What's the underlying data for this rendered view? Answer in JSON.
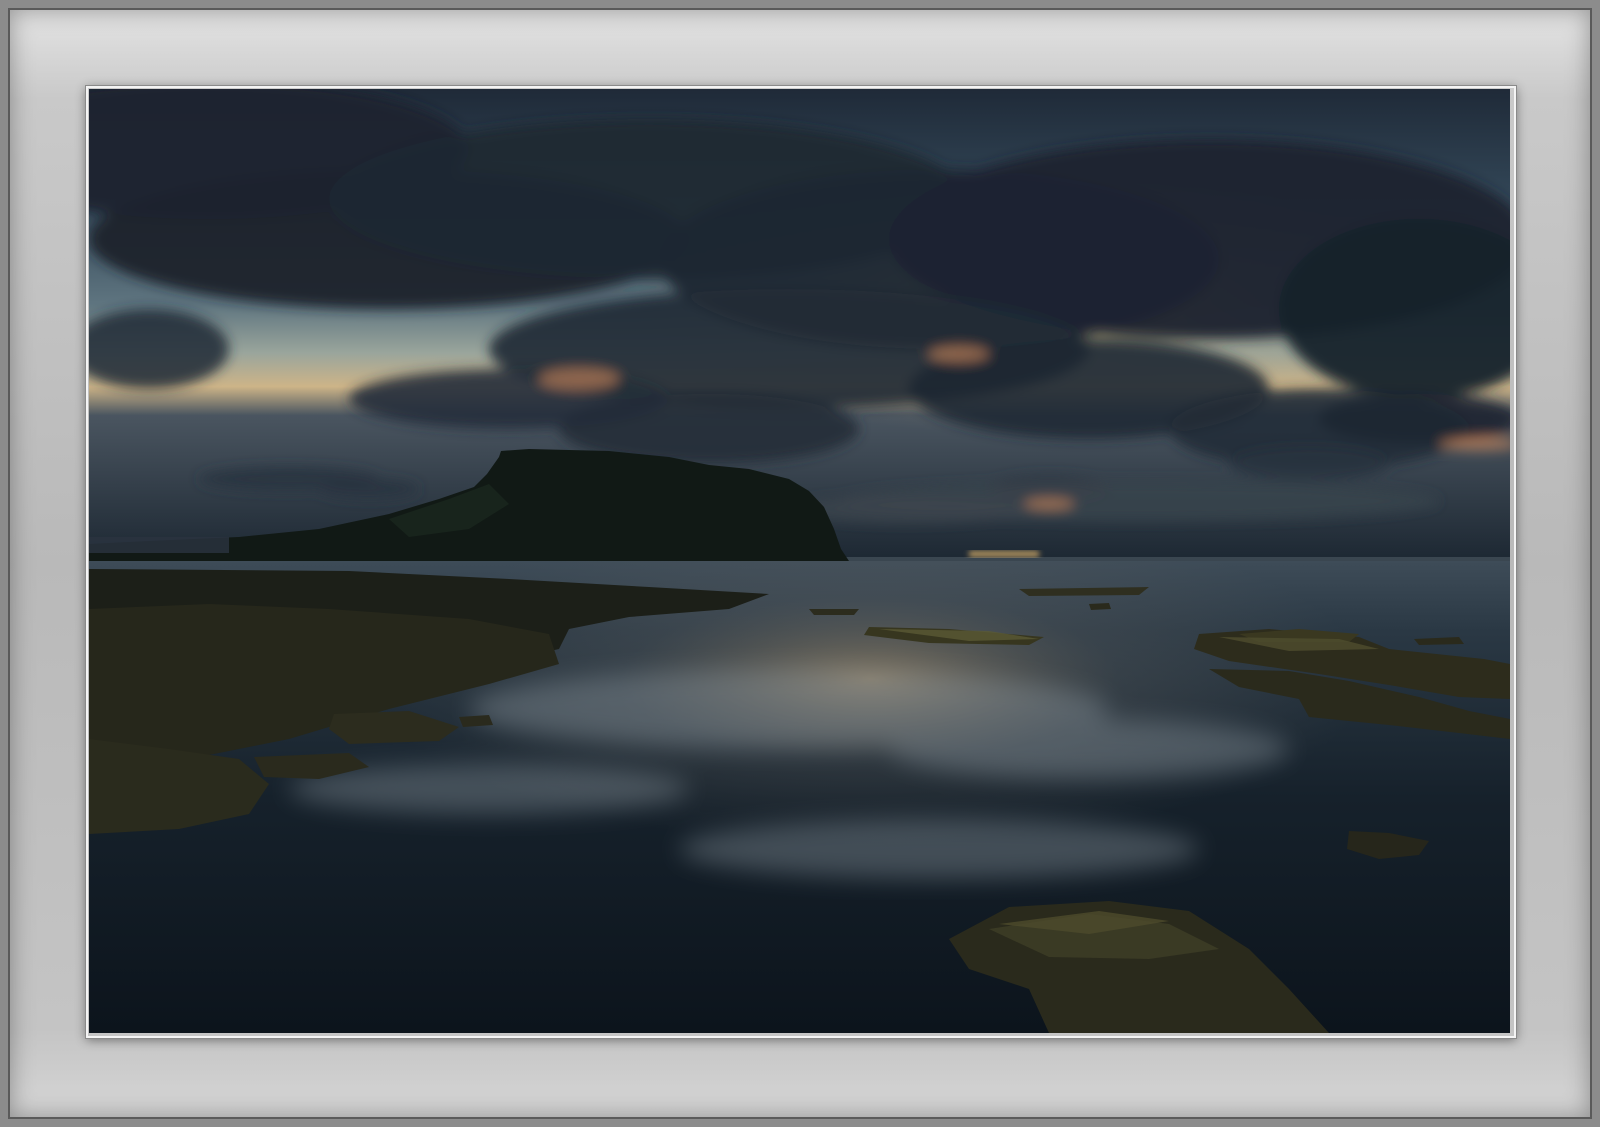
{
  "photo": {
    "subject": "coastal-sunset",
    "elements": [
      "sky",
      "clouds",
      "headland",
      "sea",
      "tide-pools",
      "rocks",
      "sun-glow",
      "reflection"
    ]
  },
  "colors": {
    "frame_border": "#8c8c8c",
    "mat": "#c4c4c4",
    "sky_top": "#1e2b3a",
    "sky_horizon": "#c8a878",
    "sun_glow": "#f2c86a",
    "cloud_dark": "#1a2430",
    "headland": "#121a17",
    "water": "#0f1822",
    "rock": "#2a2a1c"
  }
}
